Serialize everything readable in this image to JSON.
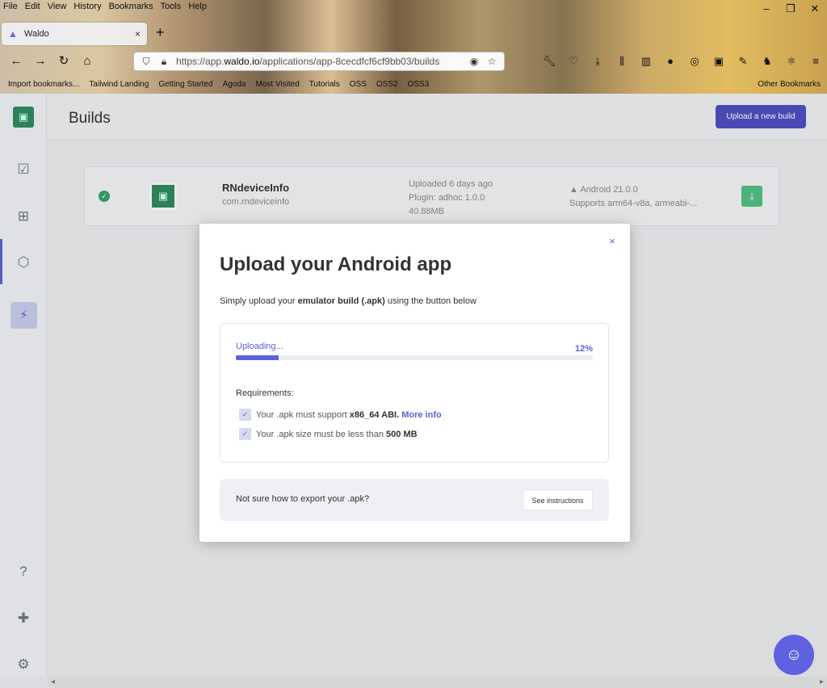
{
  "menubar": [
    "File",
    "Edit",
    "View",
    "History",
    "Bookmarks",
    "Tools",
    "Help"
  ],
  "tab": {
    "title": "Waldo",
    "close": "×",
    "new": "+"
  },
  "url": {
    "prefix": "https://app.",
    "domain": "waldo.io",
    "path": "/applications/app-8cecdfcf6cf9bb03/builds"
  },
  "bookmarks": {
    "items": [
      "Import bookmarks...",
      "Tailwind Landing",
      "Getting Started",
      "Agoda",
      "Most Visited",
      "Tutorials",
      "OSS",
      "OSS2",
      "OSS3"
    ],
    "other": "Other Bookmarks"
  },
  "header": {
    "title": "Builds",
    "upload_button": "Upload a new build"
  },
  "build": {
    "name": "RNdeviceInfo",
    "package": "com.rndeviceinfo",
    "uploaded": "Uploaded 6 days ago",
    "plugin": "Plugin: adhoc 1.0.0",
    "size": "40.88MB",
    "android": "Android 21.0.0",
    "supports": "Supports arm64-v8a, armeabi-..."
  },
  "modal": {
    "title": "Upload your Android app",
    "sub_pre": "Simply upload your ",
    "sub_bold": "emulator build (.apk)",
    "sub_post": " using the button below",
    "uploading": "Uploading...",
    "percent_label": "12%",
    "progress": 0.12,
    "requirements_title": "Requirements:",
    "req1_pre": "Your .apk must support ",
    "req1_bold": "x86_64 ABI.",
    "req1_link": "More info",
    "req2_pre": "Your .apk size must be less than ",
    "req2_bold": "500 MB",
    "help_text": "Not sure how to export your .apk?",
    "help_button": "See instructions",
    "close": "×"
  }
}
